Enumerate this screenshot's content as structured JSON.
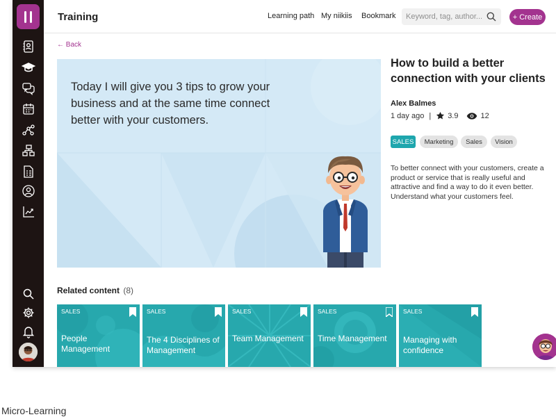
{
  "header": {
    "title": "Training",
    "nav": [
      "Learning path",
      "My niikiis",
      "Bookmark"
    ],
    "search_placeholder": "Keyword, tag, author...",
    "create_label": "+ Create"
  },
  "sidebar": {
    "items": [
      "profile-card-icon",
      "graduation-cap-icon",
      "chat-icon",
      "calendar-icon",
      "network-icon",
      "hierarchy-icon",
      "document-list-icon",
      "user-circle-icon",
      "chart-icon"
    ],
    "bottom": [
      "search-icon",
      "gear-icon",
      "bell-icon",
      "avatar"
    ]
  },
  "back_label": "← Back",
  "hero": {
    "text": "Today I will give you 3 tips to grow your business and at the same time connect better with your customers."
  },
  "course": {
    "title": "How to build a better connection with your clients",
    "author": "Alex Balmes",
    "time": "1 day ago",
    "separator": "|",
    "rating": "3.9",
    "views": "12",
    "tags": [
      "SALES",
      "Marketing",
      "Sales",
      "Vision"
    ],
    "description": "To better connect with your customers, create a product or service that is really useful and attractive and find a way to do it even better. Understand what your customers feel."
  },
  "related": {
    "label": "Related content",
    "count": "(8)",
    "cards": [
      {
        "category": "SALES",
        "title": "People Management"
      },
      {
        "category": "SALES",
        "title": "The 4 Disciplines of Management"
      },
      {
        "category": "SALES",
        "title": "Team Management"
      },
      {
        "category": "SALES",
        "title": "Time Management"
      },
      {
        "category": "SALES",
        "title": "Managing with confidence"
      }
    ]
  },
  "caption": "Micro-Learning",
  "colors": {
    "accent": "#a3338f",
    "teal": "#27a8ad",
    "sidebar": "#1d1413",
    "hero_bg": "#d4e9f6"
  }
}
